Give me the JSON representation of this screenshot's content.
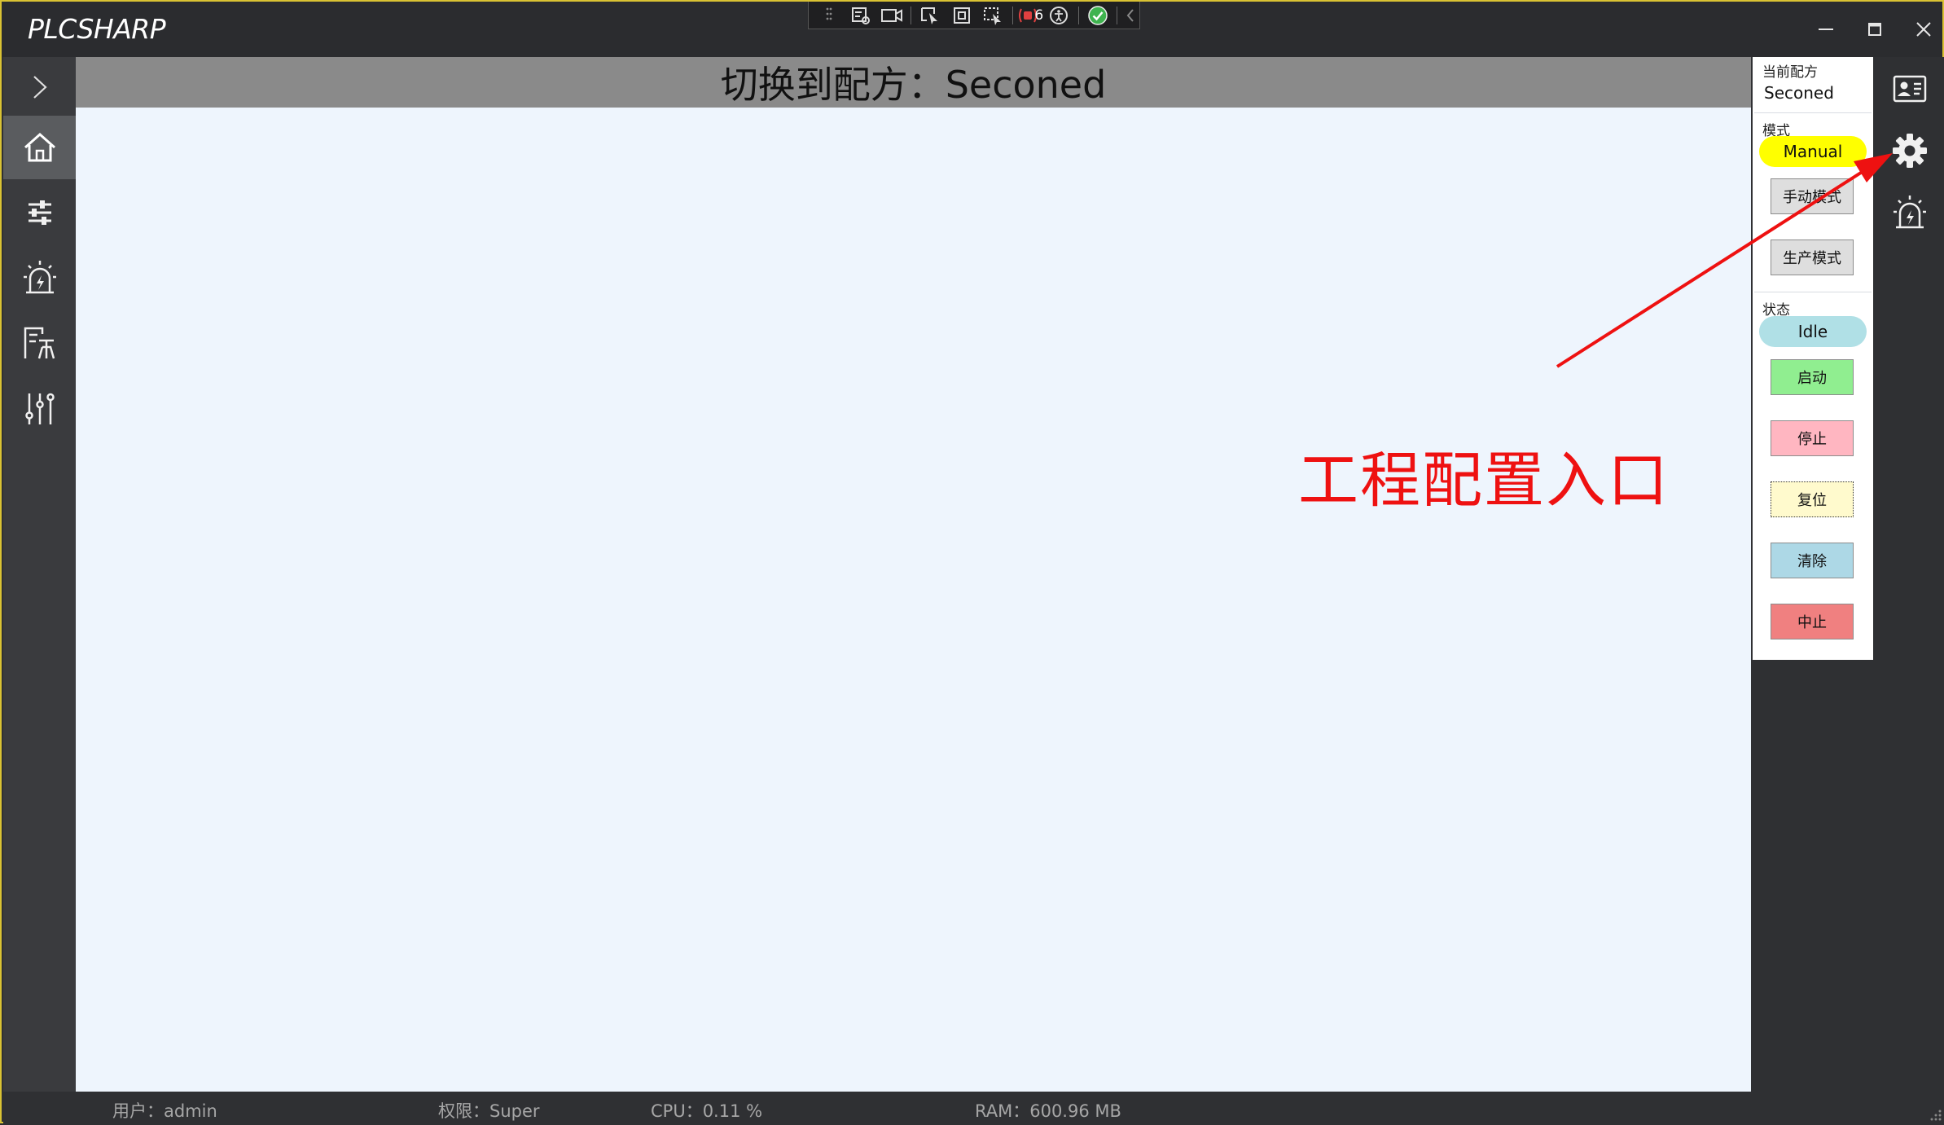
{
  "window": {
    "title": "PLCSHARP"
  },
  "debug_toolbar": {
    "count": "6"
  },
  "sidebar": {
    "items": [
      {
        "icon": "chevron-right-icon"
      },
      {
        "icon": "home-icon"
      },
      {
        "icon": "sliders-icon"
      },
      {
        "icon": "alarm-icon"
      },
      {
        "icon": "recipe-icon"
      },
      {
        "icon": "tuning-icon"
      }
    ]
  },
  "main": {
    "header": "切换到配方：Seconed"
  },
  "control_panel": {
    "recipe_label": "当前配方",
    "recipe_value": "Seconed",
    "mode_label": "模式",
    "mode_value": "Manual",
    "manual_button": "手动模式",
    "production_button": "生产模式",
    "state_label": "状态",
    "state_value": "Idle",
    "start_button": "启动",
    "stop_button": "停止",
    "reset_button": "复位",
    "clear_button": "清除",
    "abort_button": "中止"
  },
  "right_bar": {
    "items": [
      {
        "icon": "user-card-icon"
      },
      {
        "icon": "gear-icon"
      },
      {
        "icon": "alarm-icon"
      }
    ]
  },
  "annotation": {
    "text": "工程配置入口"
  },
  "status_bar": {
    "user": "用户：admin",
    "permission": "权限：Super",
    "cpu": "CPU：0.11 %",
    "ram": "RAM：600.96 MB"
  },
  "colors": {
    "mode_pill": "#ffff00",
    "state_pill": "#b0e0e6",
    "start": "#90ee90",
    "stop": "#ffb6c1",
    "reset": "#fffacd",
    "clear": "#add8e6",
    "abort": "#f08080",
    "annotation": "#ee1111"
  }
}
